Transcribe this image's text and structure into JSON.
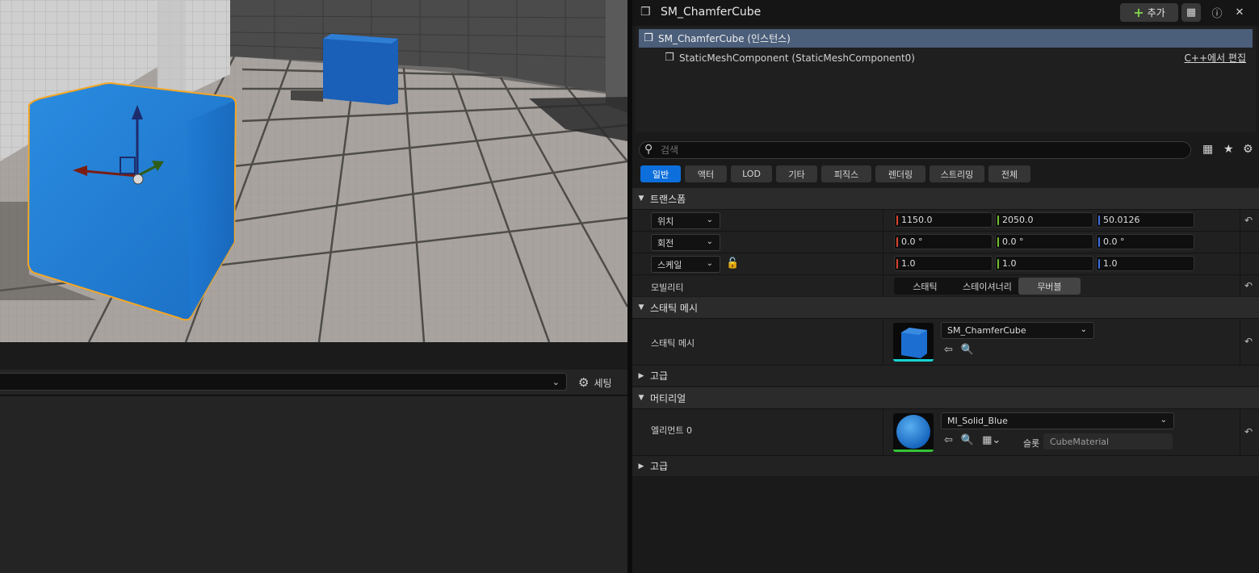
{
  "colors": {
    "accent": "#0d6fdc",
    "selection": "#4b5e7a",
    "axis_x": "#d8452e",
    "axis_y": "#6fbf2e",
    "axis_z": "#3b6fe0",
    "mesh_blue": "#1f7fd8",
    "selection_outline": "#f5a623",
    "static_mesh_underline": "#19d4d4",
    "material_underline": "#35c435"
  },
  "viewport": {
    "description_icon": "3d-viewport"
  },
  "left_panel": {
    "settings_label": "세팅",
    "settings_icon": "gear-icon"
  },
  "details": {
    "title": "SM_ChamferCube",
    "add_label": "추가",
    "outliner": {
      "root": "SM_ChamferCube (인스턴스)",
      "child": "StaticMeshComponent (StaticMeshComponent0)",
      "edit_cpp": "C++에서 편집"
    },
    "search": {
      "placeholder": "검색"
    },
    "filters": [
      "일반",
      "액터",
      "LOD",
      "기타",
      "피직스",
      "렌더링",
      "스트리밍",
      "전체"
    ],
    "transform": {
      "section": "트랜스폼",
      "location": {
        "label": "위치",
        "x": "1150.0",
        "y": "2050.0",
        "z": "50.0126"
      },
      "rotation": {
        "label": "회전",
        "x": "0.0 °",
        "y": "0.0 °",
        "z": "0.0 °"
      },
      "scale": {
        "label": "스케일",
        "x": "1.0",
        "y": "1.0",
        "z": "1.0"
      },
      "mobility": {
        "label": "모빌리티",
        "options": [
          "스태틱",
          "스테이셔너리",
          "무버블"
        ],
        "selected": "무버블"
      }
    },
    "static_mesh": {
      "section": "스태틱 메시",
      "label": "스태틱 메시",
      "value": "SM_ChamferCube",
      "advanced": "고급"
    },
    "materials": {
      "section": "머티리얼",
      "element_label": "엘리먼트 0",
      "value": "MI_Solid_Blue",
      "slot_label": "슬롯",
      "slot_value": "CubeMaterial",
      "advanced": "고급"
    }
  }
}
